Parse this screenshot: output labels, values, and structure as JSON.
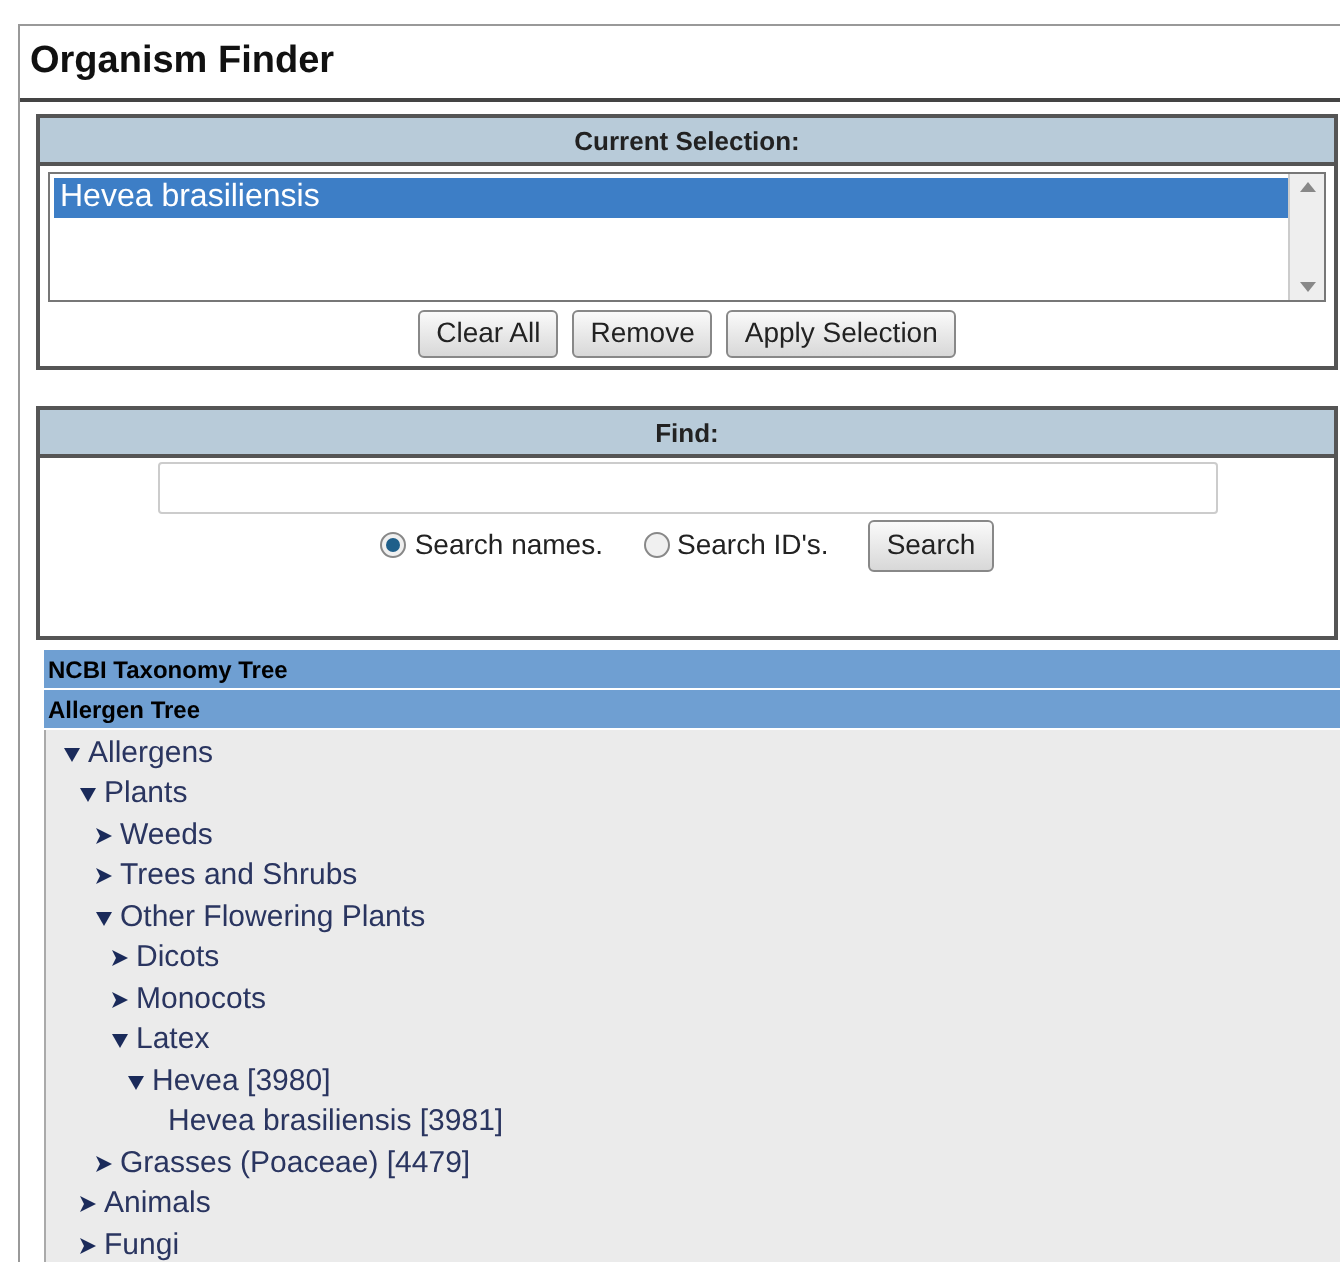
{
  "title": "Organism Finder",
  "current_selection": {
    "heading": "Current Selection:",
    "items": [
      {
        "label": "Hevea brasiliensis",
        "selected": true
      }
    ],
    "buttons": [
      "Clear All",
      "Remove",
      "Apply Selection"
    ]
  },
  "find": {
    "heading": "Find:",
    "radios": [
      {
        "label": "Search names.",
        "selected": true
      },
      {
        "label": "Search ID's.",
        "selected": false
      }
    ],
    "button": "Search"
  },
  "trees": [
    {
      "label": "NCBI Taxonomy Tree"
    },
    {
      "label": "Allergen Tree"
    }
  ],
  "tree": [
    {
      "label": "Allergens",
      "expanded": true,
      "children": [
        {
          "label": "Plants",
          "expanded": true,
          "children": [
            {
              "label": "Weeds",
              "expanded": false
            },
            {
              "label": "Trees and Shrubs",
              "expanded": false
            },
            {
              "label": "Other Flowering Plants",
              "expanded": true,
              "children": [
                {
                  "label": "Dicots",
                  "expanded": false
                },
                {
                  "label": "Monocots",
                  "expanded": false
                },
                {
                  "label": "Latex",
                  "expanded": true,
                  "children": [
                    {
                      "label": "Hevea [3980]",
                      "expanded": true,
                      "children": [
                        {
                          "label": "Hevea brasiliensis [3981]"
                        }
                      ]
                    }
                  ]
                }
              ]
            },
            {
              "label": "Grasses (Poaceae) [4479]",
              "expanded": false
            }
          ]
        },
        {
          "label": "Animals",
          "expanded": false
        },
        {
          "label": "Fungi",
          "expanded": false
        }
      ]
    }
  ]
}
